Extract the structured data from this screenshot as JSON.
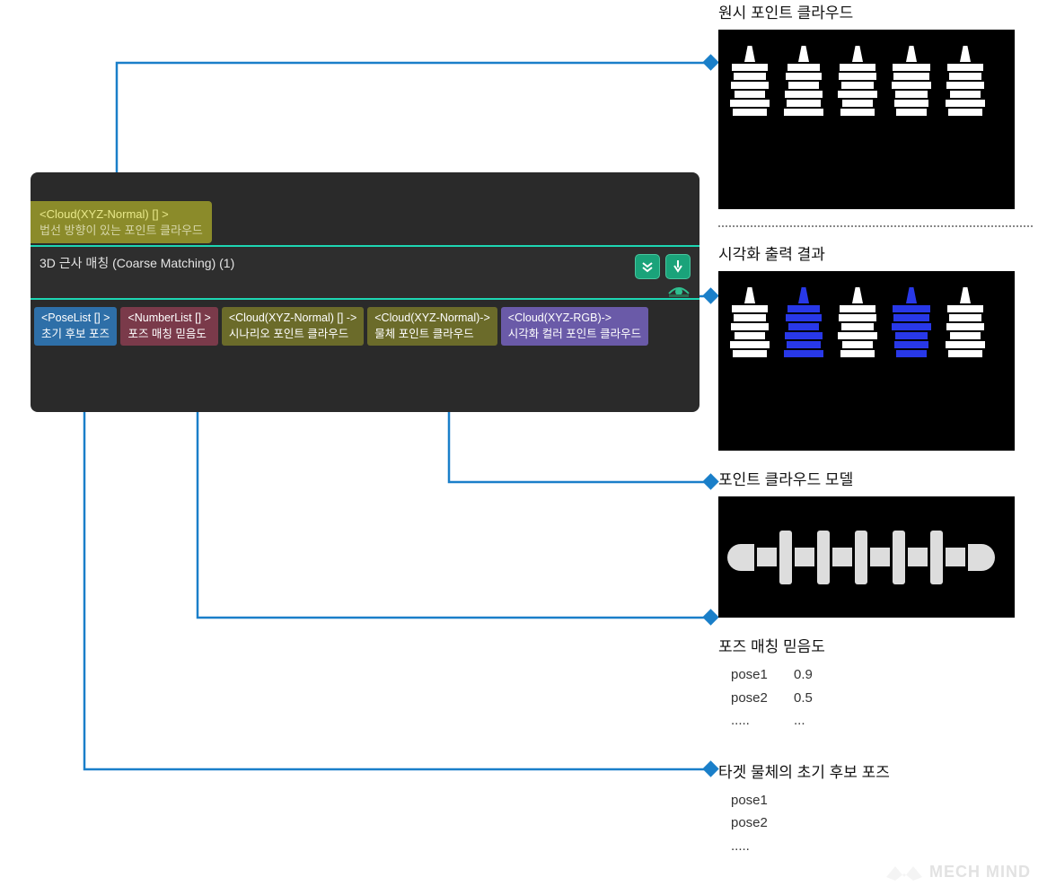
{
  "input_port": {
    "type": "<Cloud(XYZ-Normal) [] >",
    "desc": "법선 방향이 있는 포인트 클라우드"
  },
  "header": {
    "title": "3D 근사 매칭 (Coarse Matching) (1)"
  },
  "outputs": [
    {
      "type": "<PoseList [] >",
      "desc": "초기 후보 포즈",
      "cls": "c-blue"
    },
    {
      "type": "<NumberList [] >",
      "desc": "포즈 매칭 믿음도",
      "cls": "c-maroon"
    },
    {
      "type": "<Cloud(XYZ-Normal) [] ->",
      "desc": "시나리오 포인트 클라우드",
      "cls": "c-olive"
    },
    {
      "type": "<Cloud(XYZ-Normal)->",
      "desc": "물체 포인트 클라우드",
      "cls": "c-olive"
    },
    {
      "type": "<Cloud(XYZ-RGB)->",
      "desc": "시각화 컬러 포인트 클라우드",
      "cls": "c-purple"
    }
  ],
  "right": {
    "raw_title": "원시 포인트 클라우드",
    "viz_title": "시각화 출력 결과",
    "model_title": "포인트 클라우드 모델",
    "conf_title": "포즈 매칭 믿음도",
    "pose_title": "타겟 물체의 초기 후보 포즈",
    "conf_rows": [
      {
        "name": "pose1",
        "val": "0.9"
      },
      {
        "name": "pose2",
        "val": "0.5"
      },
      {
        "name": ".....",
        "val": "..."
      }
    ],
    "pose_rows": [
      {
        "name": "pose1"
      },
      {
        "name": "pose2"
      },
      {
        "name": "....."
      }
    ]
  },
  "watermark": "MECH MIND"
}
